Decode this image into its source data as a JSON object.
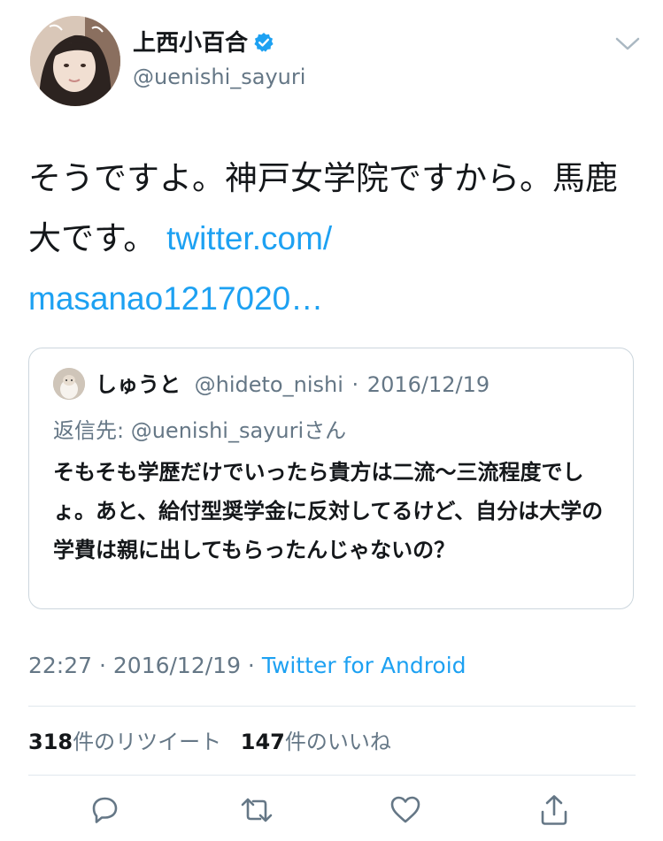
{
  "user": {
    "display_name": "上西小百合",
    "handle": "@uenishi_sayuri",
    "verified": true,
    "verified_color": "#1da1f2"
  },
  "tweet": {
    "text": "そうですよ。神戸女学院ですから。馬鹿大です。",
    "link_line1": "twitter.com/",
    "link_line2": "masanao1217020…"
  },
  "quote": {
    "name": "しゅうと",
    "handle": "@hideto_nishi",
    "separator": "·",
    "date": "2016/12/19",
    "reply_prefix": "返信先: ",
    "reply_to": "@uenishi_sayuri",
    "reply_suffix": "さん",
    "body": "そもそも学歴だけでいったら貴方は二流〜三流程度でしょ。あと、給付型奨学金に反対してるけど、自分は大学の学費は親に出してもらったんじゃないの？"
  },
  "meta": {
    "time": "22:27",
    "sep1": " · ",
    "date": "2016/12/19",
    "sep2": " · ",
    "client": "Twitter for Android"
  },
  "stats": {
    "retweet_count": "318",
    "retweet_label": "件のリツイート",
    "like_count": "147",
    "like_label": "件のいいね"
  },
  "actions": {
    "icons": [
      "reply-icon",
      "retweet-icon",
      "like-icon",
      "share-icon"
    ]
  },
  "colors": {
    "link": "#1da1f2",
    "secondary_text": "#657786",
    "primary_text": "#14171a",
    "border": "#e1e8ed"
  }
}
